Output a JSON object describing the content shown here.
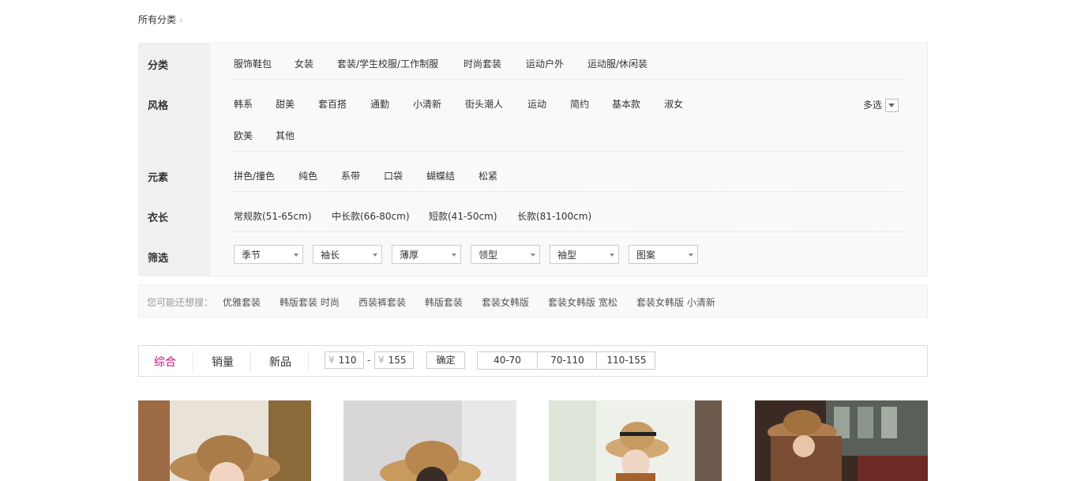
{
  "breadcrumb": {
    "label": "所有分类",
    "chevron": "›"
  },
  "filters": {
    "category": {
      "key": "分类",
      "items": [
        "服饰鞋包",
        "女装",
        "套装/学生校服/工作制服",
        "时尚套装",
        "运动户外",
        "运动服/休闲装"
      ]
    },
    "style": {
      "key": "风格",
      "items": [
        "韩系",
        "甜美",
        "套百搭",
        "通勤",
        "小清新",
        "街头潮人",
        "运动",
        "简约",
        "基本款",
        "淑女",
        "欧美",
        "其他"
      ],
      "multi_label": "多选"
    },
    "element": {
      "key": "元素",
      "items": [
        "拼色/撞色",
        "纯色",
        "系带",
        "口袋",
        "蝴蝶结",
        "松紧"
      ]
    },
    "length": {
      "key": "衣长",
      "items": [
        "常规款(51-65cm)",
        "中长款(66-80cm)",
        "短款(41-50cm)",
        "长款(81-100cm)"
      ]
    },
    "screen": {
      "key": "筛选",
      "selects": [
        "季节",
        "袖长",
        "薄厚",
        "领型",
        "袖型",
        "图案"
      ]
    }
  },
  "suggest": {
    "label": "您可能还想搜：",
    "items": [
      "优雅套装",
      "韩版套装 时尚",
      "西装裤套装",
      "韩版套装",
      "套装女韩版",
      "套装女韩版 宽松",
      "套装女韩版 小清新"
    ]
  },
  "sort": {
    "tabs": [
      "综合",
      "销量",
      "新品"
    ],
    "active_tab": "综合",
    "currency": "¥",
    "price_min": "110",
    "price_dash": "-",
    "price_max": "155",
    "confirm": "确定",
    "ranges": [
      "40-70",
      "70-110",
      "110-155"
    ]
  },
  "colors": {
    "accent": "#c40e76"
  }
}
